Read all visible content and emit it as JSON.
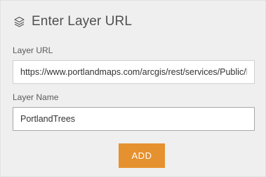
{
  "dialog": {
    "title": "Enter Layer URL",
    "icon": "layers-icon"
  },
  "layer_url": {
    "label": "Layer URL",
    "value": "https://www.portlandmaps.com/arcgis/rest/services/Public/Parks_Tree_Inventory/MapServer"
  },
  "layer_name": {
    "label": "Layer Name",
    "value": "PortlandTrees"
  },
  "actions": {
    "add_label": "ADD",
    "add_color": "#e6912f"
  }
}
